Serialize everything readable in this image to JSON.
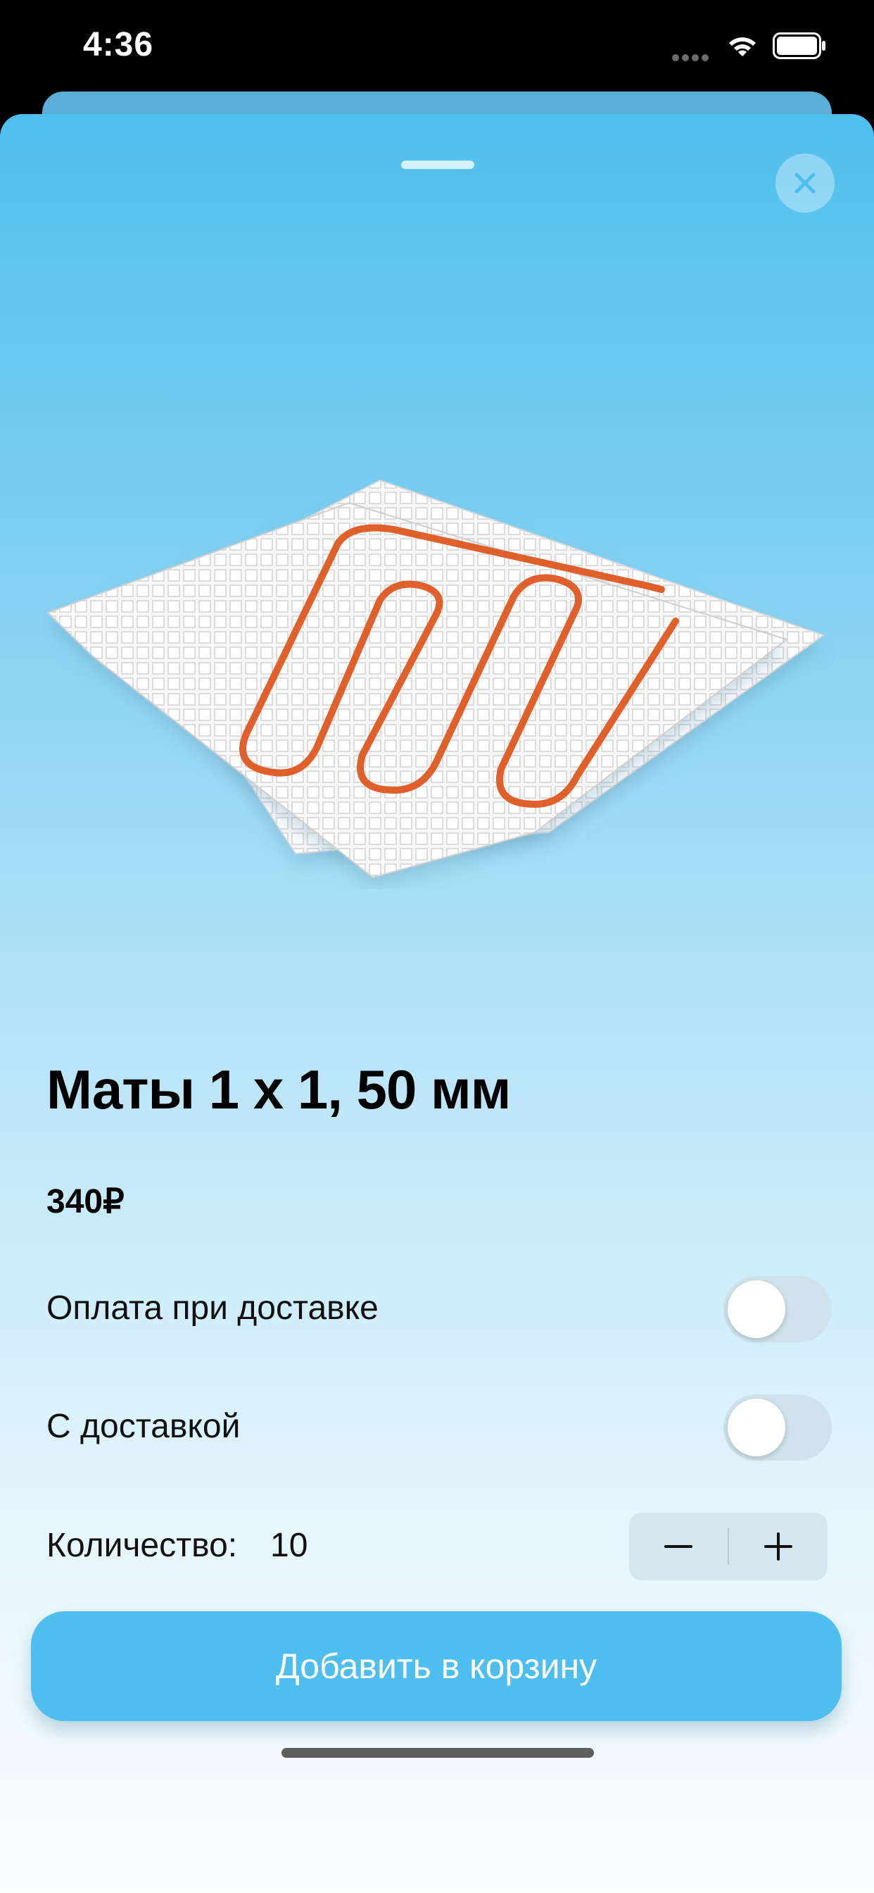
{
  "status_bar": {
    "time": "4:36",
    "icons": [
      "signal-icon",
      "wifi-icon",
      "battery-icon"
    ]
  },
  "product": {
    "title": "Маты 1 x 1, 50 мм",
    "price": "340₽",
    "image_alt": "insulated heating floor mats"
  },
  "options": {
    "cod_label": "Оплата при доставке",
    "cod_enabled": false,
    "delivery_label": "С доставкой",
    "delivery_enabled": false
  },
  "quantity": {
    "label": "Количество:",
    "value": "10",
    "decrement_icon": "minus-icon",
    "increment_icon": "plus-icon"
  },
  "actions": {
    "add_to_cart": "Добавить в корзину",
    "close_icon": "close-icon"
  },
  "colors": {
    "accent": "#4ebeee",
    "sheet_top": "#4fbfee",
    "sheet_bottom": "#fbfdfe",
    "heating_pipe": "#e0602b"
  }
}
